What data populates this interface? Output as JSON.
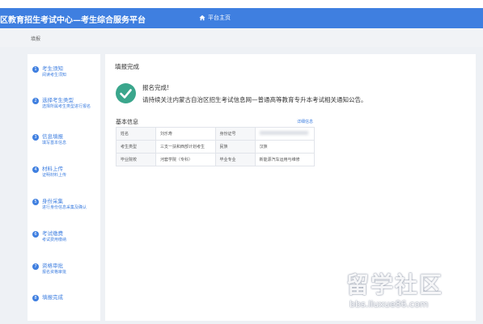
{
  "header": {
    "site_title": "区教育招生考试中心—考生综合服务平台",
    "home_label": "平台主页",
    "home_icon": "home-icon",
    "bar_color": "#3f7fe0"
  },
  "breadcrumb": {
    "label": "填报"
  },
  "sidebar": {
    "steps": [
      {
        "num": "1",
        "title": "考生须知",
        "desc": "阅读考生须知"
      },
      {
        "num": "2",
        "title": "选择考生类型",
        "desc": "选择所属考生类型进行报名"
      },
      {
        "num": "3",
        "title": "信息填报",
        "desc": "填写基本信息"
      },
      {
        "num": "4",
        "title": "材料上传",
        "desc": "证明材料上传"
      },
      {
        "num": "5",
        "title": "身份采集",
        "desc": "进行身份信息采集及确认"
      },
      {
        "num": "6",
        "title": "考试缴费",
        "desc": "考试费用缴纳"
      },
      {
        "num": "7",
        "title": "资格审批",
        "desc": "报名资格审批"
      },
      {
        "num": "8",
        "title": "填报完成",
        "desc": ""
      }
    ]
  },
  "main": {
    "page_title": "填报完成",
    "success_icon": "check-circle-icon",
    "success_title": "报名完成!",
    "success_message": "请持续关注内蒙古自治区招生考试信息网—普通高等教育专升本考试相关通知公告。",
    "section_title": "基本信息",
    "detail_link": "详细信息",
    "table": {
      "rows": [
        {
          "label1": "姓名",
          "value1": "刘乐寿",
          "label2": "身份证号",
          "value2": ""
        },
        {
          "label1": "考生类型",
          "value1": "三支一扶和西部计划考生",
          "label2": "民族",
          "value2": "汉族"
        },
        {
          "label1": "毕业院校",
          "value1": "河套学院（专科）",
          "label2": "毕业专业",
          "value2": "新能源汽车运用与维修"
        }
      ]
    }
  },
  "watermark": {
    "brand": "留学社区",
    "url": "bbs.liuxue86.com"
  }
}
